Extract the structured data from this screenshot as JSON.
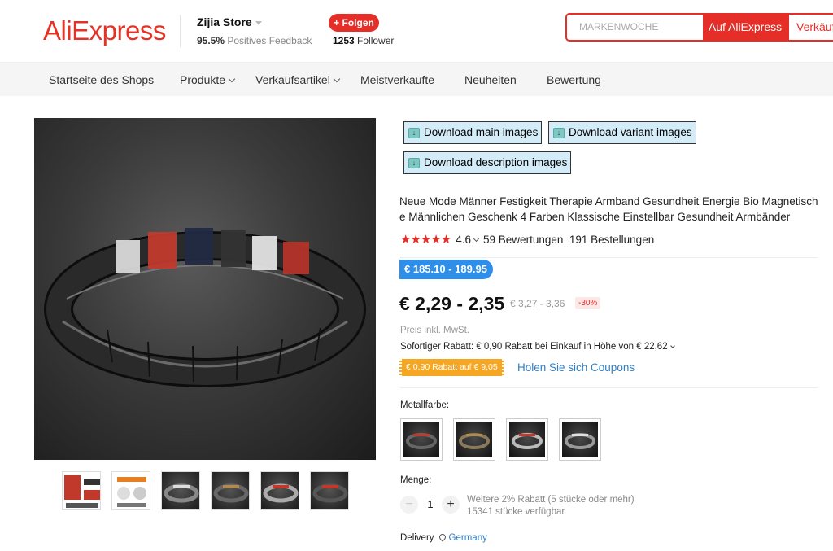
{
  "header": {
    "logo_text": "AliExpress",
    "store_name": "Zijia Store",
    "feedback_percent": "95.5%",
    "feedback_label": "Positives Feedback",
    "follow_label": "+ Folgen",
    "follower_count": "1253",
    "follower_label": "Follower",
    "search_placeholder": "MARKENWOCHE",
    "search_aliexpress_label": "Auf AliExpress",
    "search_store_label": "Verkäufer"
  },
  "nav": {
    "items": [
      {
        "label": "Startseite des Shops",
        "has_dropdown": false
      },
      {
        "label": "Produkte",
        "has_dropdown": true
      },
      {
        "label": "Verkaufsartikel",
        "has_dropdown": true
      },
      {
        "label": "Meistverkaufte",
        "has_dropdown": false
      },
      {
        "label": "Neuheiten",
        "has_dropdown": false
      },
      {
        "label": "Bewertung",
        "has_dropdown": false
      }
    ]
  },
  "downloads": {
    "main": "Download main images",
    "variant": "Download variant images",
    "description": "Download description images"
  },
  "product": {
    "title": "Neue Mode Männer Festigkeit Therapie Armband Gesundheit Energie Bio Magnetische Männlichen Geschenk 4 Farben Klassische Einstellbar Gesundheit Armbänder",
    "stars": "★★★★★",
    "rating": "4.6",
    "reviews": "59 Bewertungen",
    "orders": "191 Bestellungen",
    "price_badge": "€ 185.10 - 189.95",
    "price": "€ 2,29 - 2,35",
    "old_price": "€ 3,27 - 3,36",
    "discount": "-30%",
    "tax_note": "Preis inkl. MwSt.",
    "instant_discount": "Sofortiger Rabatt: € 0,90 Rabatt bei Einkauf in Höhe von € 22,62",
    "coupon_label": "€ 0,90 Rabatt auf € 9,05",
    "coupon_link": "Holen Sie sich Coupons",
    "color_label": "Metallfarbe:",
    "quantity_label": "Menge:",
    "quantity_value": "1",
    "qty_minus": "−",
    "qty_plus": "+",
    "bulk_discount": "Weitere 2% Rabatt (5 stücke oder mehr)",
    "stock": "15341 stücke verfügbar",
    "delivery_label": "Delivery",
    "delivery_country": "Germany"
  },
  "colors": {
    "brand_red": "#e62e28",
    "badge_blue": "#2f8ee8",
    "coupon_orange": "#f5a623",
    "link_blue": "#2f80c7"
  }
}
